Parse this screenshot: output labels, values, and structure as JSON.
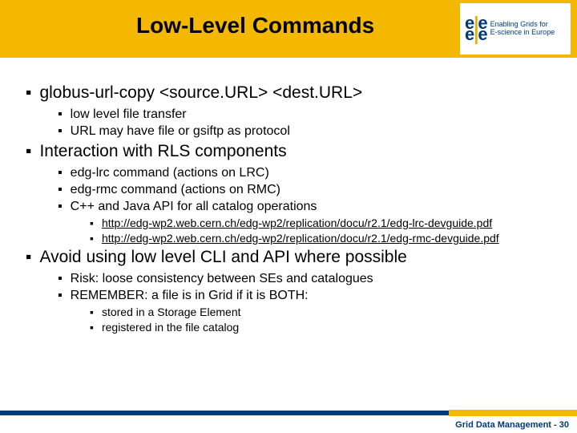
{
  "title": "Low-Level Commands",
  "logo": {
    "line1": "Enabling Grids for",
    "line2": "E-science in Europe"
  },
  "b1": {
    "t": "globus-url-copy <source.URL> <dest.URL>",
    "s": [
      "low level file transfer",
      "URL may have file or gsiftp as protocol"
    ]
  },
  "b2": {
    "t": "Interaction with RLS components",
    "s": [
      "edg-lrc command (actions on LRC)",
      "edg-rmc command (actions on RMC)",
      "C++ and Java API for all catalog operations"
    ],
    "links": [
      "http://edg-wp2.web.cern.ch/edg-wp2/replication/docu/r2.1/edg-lrc-devguide.pdf",
      "http://edg-wp2.web.cern.ch/edg-wp2/replication/docu/r2.1/edg-rmc-devguide.pdf"
    ]
  },
  "b3": {
    "t": "Avoid using low level CLI and API where possible",
    "s": [
      "Risk: loose consistency between SEs and catalogues",
      "REMEMBER: a file is in Grid if it is BOTH:"
    ],
    "ss": [
      "stored in a Storage Element",
      "registered in the file catalog"
    ]
  },
  "footer": "Grid Data Management - 30"
}
